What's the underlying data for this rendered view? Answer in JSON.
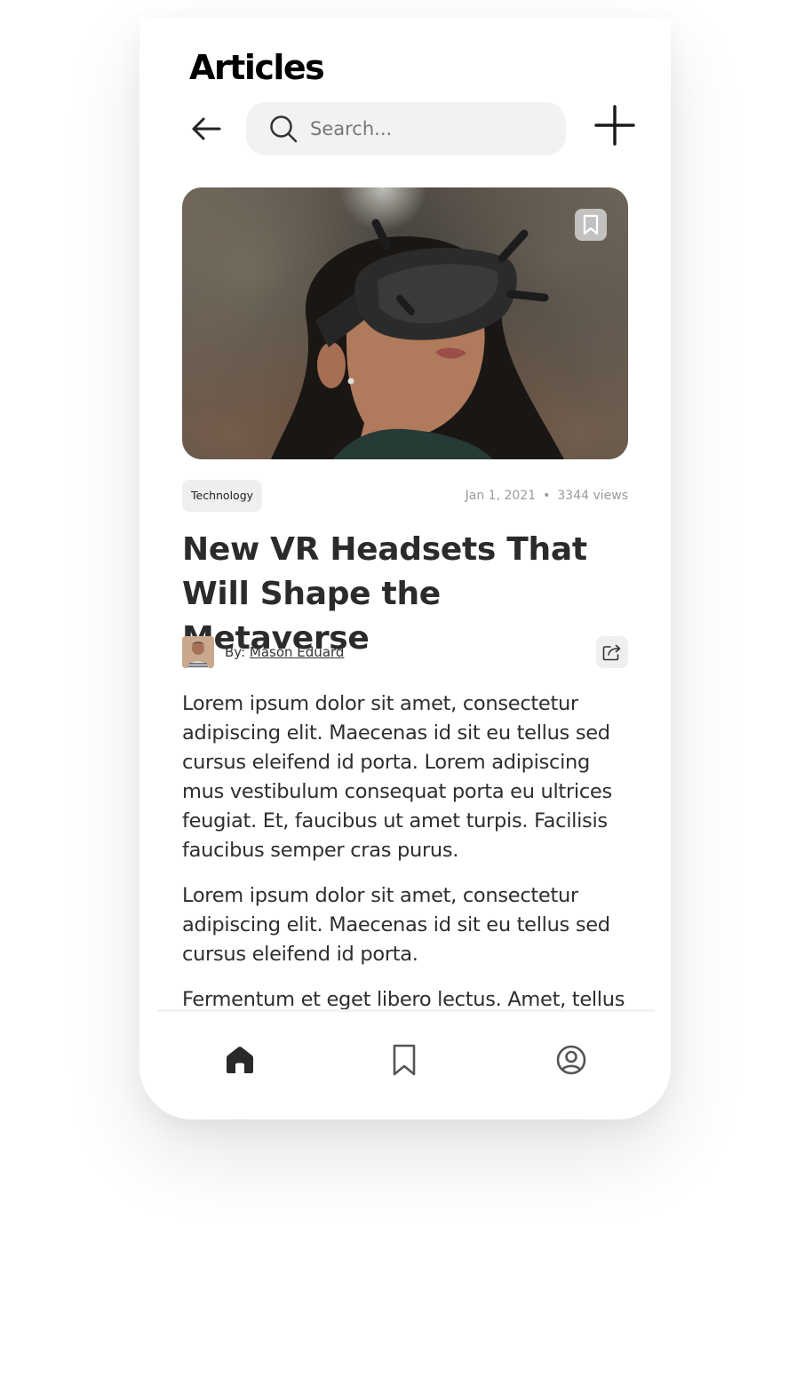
{
  "header": {
    "title": "Articles",
    "back_icon": "arrow-left-icon",
    "add_icon": "plus-icon"
  },
  "search": {
    "placeholder": "Search...",
    "value": "",
    "icon": "search-icon"
  },
  "article": {
    "category": "Technology",
    "date": "Jan 1, 2021",
    "separator": "•",
    "views": "3344 views",
    "title": "New VR Headsets That Will Shape the Metaverse",
    "author_prefix": "By: ",
    "author_name": "Mason Eduard",
    "image_bookmark_icon": "bookmark-icon",
    "share_icon": "share-icon",
    "paragraphs": [
      "Lorem ipsum dolor sit amet, consectetur adipiscing elit. Maecenas id sit eu tellus sed cursus eleifend id porta. Lorem adipiscing mus vestibulum consequat porta eu ultrices feugiat. Et, faucibus ut amet turpis. Facilisis faucibus semper cras purus.",
      "Lorem ipsum dolor sit amet, consectetur adipiscing elit. Maecenas id sit eu tellus sed cursus eleifend id porta.",
      "Fermentum et eget libero lectus. Amet, tellus"
    ]
  },
  "bottom_nav": {
    "items": [
      {
        "icon": "home-icon",
        "active": true
      },
      {
        "icon": "bookmark-icon",
        "active": false
      },
      {
        "icon": "profile-icon",
        "active": false
      }
    ]
  },
  "colors": {
    "text_primary": "#2b2b2b",
    "search_bg": "#f2f2f2",
    "tag_bg": "#efefef",
    "meta_text": "#9a9a9a"
  }
}
